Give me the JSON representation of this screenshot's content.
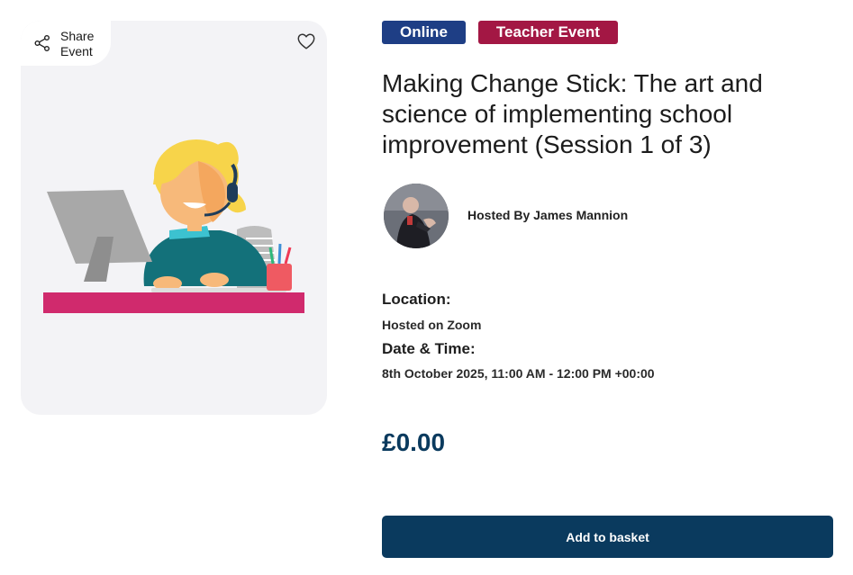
{
  "media": {
    "share_label": "Share Event",
    "share_icon": "share-icon",
    "favorite_icon": "heart-icon"
  },
  "badges": {
    "online": "Online",
    "teacher": "Teacher Event",
    "online_color": "#1e3e85",
    "teacher_color": "#a31744"
  },
  "event": {
    "title": "Making Change Stick: The art and science of implementing school improvement (Session 1 of 3)",
    "host_text": "Hosted By James Mannion"
  },
  "details": {
    "location_heading": "Location:",
    "location_value": "Hosted on Zoom",
    "datetime_heading": "Date & Time:",
    "datetime_value": "8th October 2025, 11:00 AM - 12:00 PM +00:00"
  },
  "purchase": {
    "price": "£0.00",
    "button_label": "Add to basket",
    "accent_color": "#0a3a5e"
  }
}
